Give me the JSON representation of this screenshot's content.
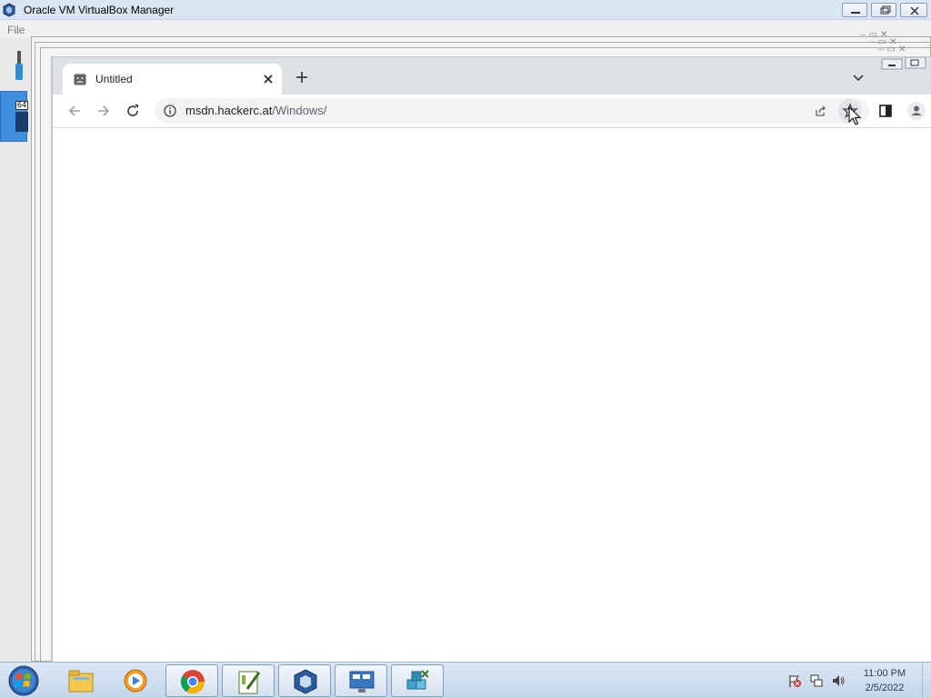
{
  "vbox": {
    "title": "Oracle VM VirtualBox Manager",
    "menu_file": "File",
    "vm_badge": "64"
  },
  "chrome": {
    "tab": {
      "title": "Untitled"
    },
    "omnibox": {
      "host": "msdn.hackerc.at",
      "path": "/Windows/"
    }
  },
  "taskbar": {
    "apps": [
      {
        "name": "Windows Explorer",
        "icon": "folder-icon"
      },
      {
        "name": "Windows Media Player",
        "icon": "media-player-icon"
      },
      {
        "name": "Google Chrome",
        "icon": "chrome-icon"
      },
      {
        "name": "Notepad++",
        "icon": "editor-icon"
      },
      {
        "name": "Oracle VM VirtualBox",
        "icon": "virtualbox-icon"
      },
      {
        "name": "Remote Desktop",
        "icon": "remote-desktop-icon"
      },
      {
        "name": "Hyper-V",
        "icon": "cubes-icon"
      }
    ],
    "clock": {
      "time": "11:00 PM",
      "date": "2/5/2022"
    }
  },
  "colors": {
    "titlebar": "#dbe6f4",
    "chrome_tabstrip": "#dee1e6",
    "omnibox": "#f1f3f4",
    "taskbar": "#c3d5ea"
  }
}
